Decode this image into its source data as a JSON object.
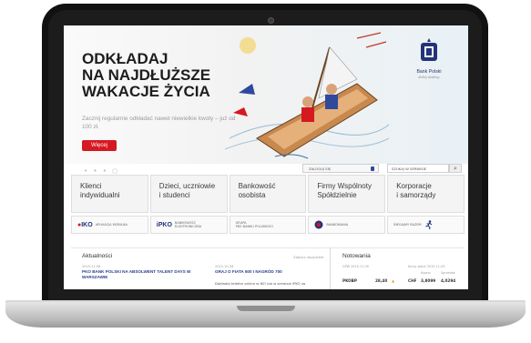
{
  "hero": {
    "headline_line1": "ODKŁADAJ",
    "headline_line2": "NA NAJDŁUŻSZE",
    "headline_line3": "WAKACJE ŻYCIA",
    "subtext": "Zacznij regularnie odkładać nawet niewielkie kwoty – już od 100 zł.",
    "more_button": "Więcej"
  },
  "logo": {
    "name": "Bank Polski",
    "tagline": "dobry dodany"
  },
  "utility": {
    "login_label": "ZALOGUJ SIĘ",
    "search_placeholder": "SZUKAJ W SERWISIE"
  },
  "nav_tiles": [
    {
      "label": "Klienci\nindywidualni"
    },
    {
      "label": "Dzieci, uczniowie\ni studenci"
    },
    {
      "label": "Bankowość\nosobista"
    },
    {
      "label": "Firmy Wspólnoty\nSpółdzielnie"
    },
    {
      "label": "Korporacje\ni samorządy"
    }
  ],
  "services": [
    {
      "logo": "IKO",
      "text": "APLIKACJA MOBILNA"
    },
    {
      "logo": "iPKO",
      "text": "BANKOWOŚĆ\nELEKTRONICZNA"
    },
    {
      "logo": "",
      "text": "GRUPA\nPKO BANKU POLSKIEGO"
    },
    {
      "logo": "",
      "text": "BANKOMANIA"
    },
    {
      "logo": "",
      "text": "BIEGAJMY RAZEM"
    }
  ],
  "news": {
    "title": "Aktualności",
    "see_all": "Zobacz wszystkie",
    "items": [
      {
        "date": "2015-11-06",
        "headline": "PKO BANK POLSKI NA ABSOLWENT TALENT DAYS W WARSZAWIE",
        "body": ""
      },
      {
        "date": "2015-10-28",
        "headline": "GRAJ O FIATA 500 I NAGRÓD 700",
        "body": "Dokładaj telefon online w IKO lub w serwisie iPKO za"
      }
    ]
  },
  "quotes": {
    "title": "Notowania",
    "gpw_date": "GPW 2015-11-09",
    "fx_date": "Kursy walut 2015-11-09",
    "buy_label": "Kupno",
    "sell_label": "Sprzedaż",
    "stock_name": "PKOBP",
    "stock_value": "28,40",
    "fx_code": "CHF",
    "fx_buy": "3,8099",
    "fx_sell": "4,0294"
  },
  "colors": {
    "brand_red": "#d61820",
    "brand_navy": "#23337a"
  }
}
